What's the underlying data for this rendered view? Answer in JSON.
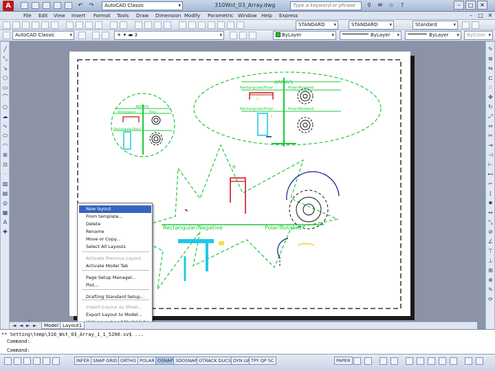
{
  "window": {
    "app_logo": "A",
    "workspace": "AutoCAD Classic",
    "title": "310Wst_03_Array.dwg",
    "search_placeholder": "Type a keyword or phrase",
    "controls": [
      "–",
      "□",
      "✕"
    ]
  },
  "menubar": {
    "items": [
      "File",
      "Edit",
      "View",
      "Insert",
      "Format",
      "Tools",
      "Draw",
      "Dimension",
      "Modify",
      "Parametric",
      "Window",
      "Help",
      "Express"
    ]
  },
  "toolbar_styles": {
    "text_style": "STANDARD",
    "dim_style": "STANDARD",
    "table_style": "Standard",
    "workspace2": "AutoCAD Classic",
    "layer": "3"
  },
  "properties": {
    "color": "ByLayer",
    "linetype": "ByLayer",
    "lineweight": "ByLayer",
    "plotstyle": "ByColor"
  },
  "drawing": {
    "ellipse_title": "ARRAYS",
    "ellipse_label_left": "Rectangular/Polar",
    "ellipse_label_right": "Polar/Rotated",
    "ellipse_label_bl": "Rectangular/Polar",
    "ellipse_label_br": "Polar/Rotated",
    "circle_title": "ARRAYS",
    "circle_label_left": "Rectangular",
    "circle_label_right": "Polar",
    "circle_label_bl": "Rectangular/Polar",
    "star_label_left": "Rectangular/Negative",
    "star_label_right": "Polar/Rotated",
    "star_letter": "e"
  },
  "context_menu": {
    "items": [
      {
        "label": "New layout",
        "state": "selected"
      },
      {
        "label": "From template...",
        "state": "normal"
      },
      {
        "label": "Delete",
        "state": "normal"
      },
      {
        "label": "Rename",
        "state": "normal"
      },
      {
        "label": "Move or Copy...",
        "state": "normal"
      },
      {
        "label": "Select All Layouts",
        "state": "normal"
      },
      {
        "label": "Activate Previous Layout",
        "state": "disabled"
      },
      {
        "label": "Activate Model Tab",
        "state": "normal"
      },
      {
        "label": "Page Setup Manager...",
        "state": "normal"
      },
      {
        "label": "Plot...",
        "state": "normal"
      },
      {
        "label": "Drafting Standard Setup...",
        "state": "normal"
      },
      {
        "label": "Import Layout as Sheet...",
        "state": "disabled"
      },
      {
        "label": "Export Layout to Model...",
        "state": "normal"
      },
      {
        "label": "Hide Layout and Model tabs",
        "state": "normal"
      }
    ]
  },
  "tabs": {
    "nav": [
      "◄",
      "◄",
      "►",
      "►"
    ],
    "items": [
      "Model",
      "Layout1"
    ]
  },
  "command": {
    "history": "** Setting\\temp\\310_Wst_03_Array_1_1_5200.sv$ ...",
    "line2": "Command: ",
    "prompt": "Command:"
  },
  "status": {
    "coords": "",
    "toggles": [
      {
        "label": "INFER",
        "on": false
      },
      {
        "label": "SNAP GRID",
        "on": false
      },
      {
        "label": "ORTHO",
        "on": false
      },
      {
        "label": "POLAR",
        "on": false
      },
      {
        "label": "OSNAP",
        "on": true
      },
      {
        "label": "3DOSNAP",
        "on": false
      },
      {
        "label": "OTRACK DUCS",
        "on": false
      },
      {
        "label": "DYN LWT",
        "on": false
      },
      {
        "label": "TPY QP SC",
        "on": false
      }
    ],
    "paper": "PAPER"
  },
  "colors": {
    "green": "#1fc83a",
    "red": "#c8141a",
    "cyan": "#1fc8e6",
    "navy": "#0a1a8c",
    "yellow": "#f0e050"
  }
}
